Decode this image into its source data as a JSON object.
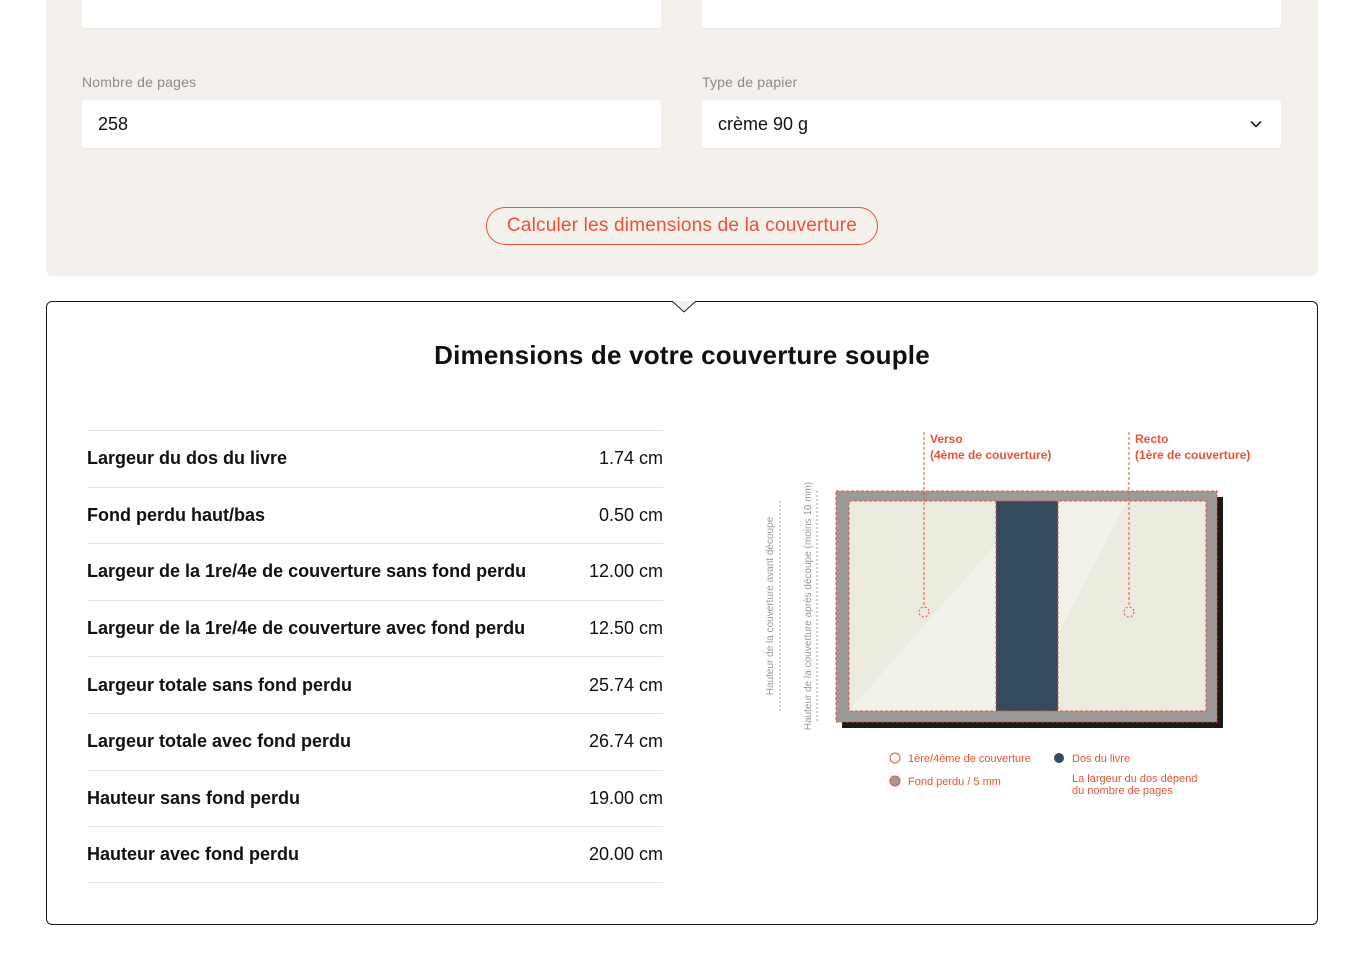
{
  "form": {
    "pages_label": "Nombre de pages",
    "pages_value": "258",
    "paper_label": "Type de papier",
    "paper_value": "crème 90 g",
    "calculate_button": "Calculer les dimensions de la couverture"
  },
  "results": {
    "title": "Dimensions de votre couverture souple",
    "rows": [
      {
        "label": "Largeur du dos du livre",
        "value": "1.74 cm"
      },
      {
        "label": "Fond perdu haut/bas",
        "value": "0.50 cm"
      },
      {
        "label": "Largeur de la 1re/4e de couverture sans fond perdu",
        "value": "12.00 cm"
      },
      {
        "label": "Largeur de la 1re/4e de couverture avec fond perdu",
        "value": "12.50 cm"
      },
      {
        "label": "Largeur totale sans fond perdu",
        "value": "25.74 cm"
      },
      {
        "label": "Largeur totale avec fond perdu",
        "value": "26.74 cm"
      },
      {
        "label": "Hauteur sans fond perdu",
        "value": "19.00 cm"
      },
      {
        "label": "Hauteur avec fond perdu",
        "value": "20.00 cm"
      }
    ]
  },
  "diagram": {
    "verso_title": "Verso",
    "verso_sub": "(4ème de couverture)",
    "recto_title": "Recto",
    "recto_sub": "(1ère de couverture)",
    "height_before_cut": "Hauteur de la couverture avant découpe",
    "height_after_cut": "Hauteur de la couverture après découpe (moins 10 mm)",
    "legend_cover": "1ère/4ème de couverture",
    "legend_spine": "Dos du livre",
    "legend_bleed": "Fond perdu / 5 mm",
    "legend_spine_note_1": "La largeur du dos dépend",
    "legend_spine_note_2": "du nombre de pages"
  },
  "colors": {
    "accent": "#e8523a",
    "panel_bg": "#f4f1ec",
    "spine": "#344a5e",
    "cover": "#ecebdf",
    "bleed": "#9c9a98"
  },
  "icons": {
    "select": "chevron-down-icon"
  }
}
